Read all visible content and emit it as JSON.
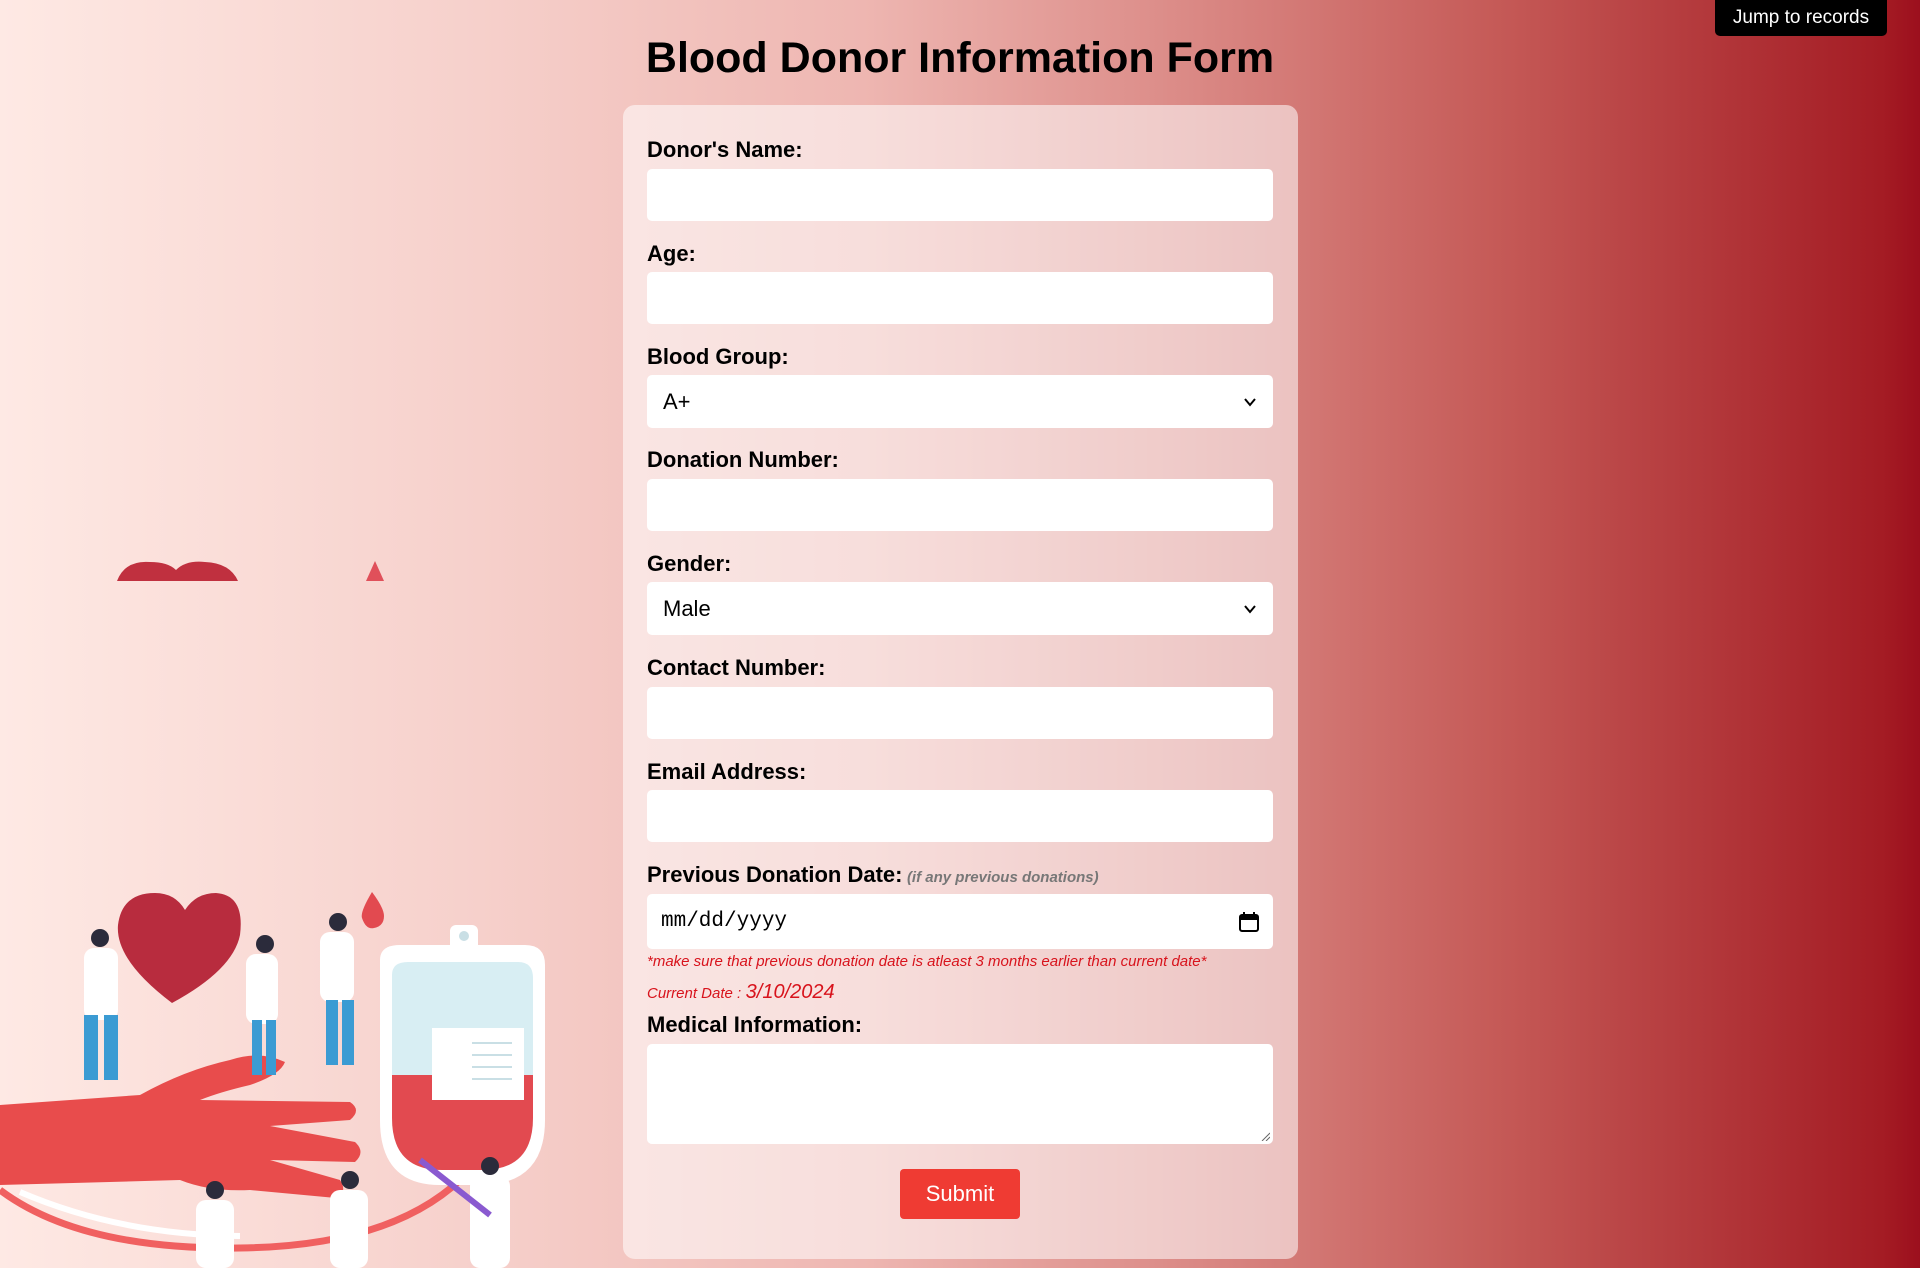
{
  "header": {
    "jump_button": "Jump to records",
    "title": "Blood Donor Information Form"
  },
  "form": {
    "donor_name_label": "Donor's Name:",
    "age_label": "Age:",
    "blood_group_label": "Blood Group:",
    "blood_group_value": "A+",
    "donation_number_label": "Donation Number:",
    "gender_label": "Gender:",
    "gender_value": "Male",
    "contact_number_label": "Contact Number:",
    "email_label": "Email Address:",
    "prev_donation_label": "Previous Donation Date:",
    "prev_donation_hint": "(if any previous donations)",
    "prev_donation_placeholder": "mm/dd/yyyy",
    "warning": "*make sure that previous donation date is atleast 3 months earlier than current date*",
    "current_date_label": "Current Date :",
    "current_date_value": "3/10/2024",
    "medical_label": "Medical Information:",
    "submit_label": "Submit"
  },
  "colors": {
    "accent_red": "#ef3b33",
    "warning_red": "#d8131c",
    "jump_button_bg": "#000000"
  },
  "icons": {
    "select_chevron": "chevron-down-icon",
    "date_picker": "calendar-icon",
    "textarea_resize": "resize-grip-icon"
  }
}
